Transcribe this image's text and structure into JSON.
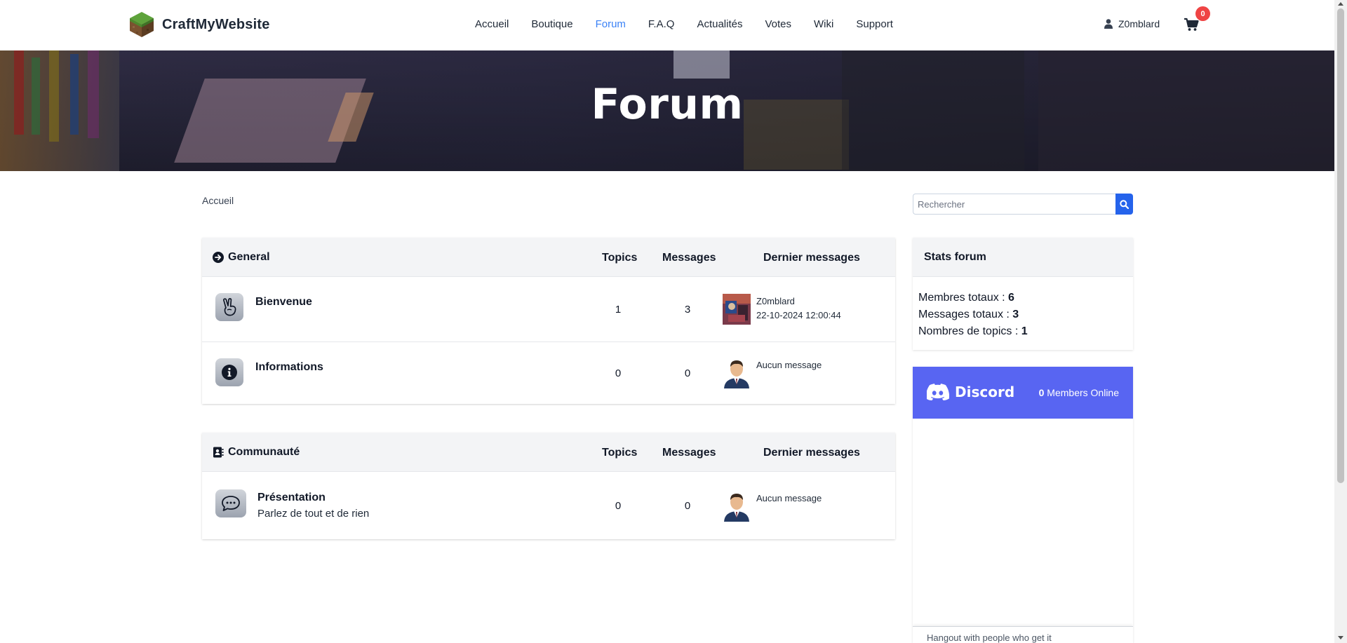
{
  "header": {
    "brand": "CraftMyWebsite",
    "nav": [
      "Accueil",
      "Boutique",
      "Forum",
      "F.A.Q",
      "Actualités",
      "Votes",
      "Wiki",
      "Support"
    ],
    "active_nav": "Forum",
    "username": "Z0mblard",
    "cart_count": "0"
  },
  "hero": {
    "title": "Forum"
  },
  "breadcrumb": "Accueil",
  "search": {
    "placeholder": "Rechercher"
  },
  "columns": {
    "topics": "Topics",
    "messages": "Messages",
    "last": "Dernier messages"
  },
  "categories": [
    {
      "name": "General",
      "icon": "arrow-circle-right-icon",
      "forums": [
        {
          "name": "Bienvenue",
          "description": "",
          "icon": "hand-peace-icon",
          "topics": "1",
          "messages": "3",
          "last_author": "Z0mblard",
          "last_date": "22-10-2024 12:00:44"
        },
        {
          "name": "Informations",
          "description": "",
          "icon": "info-circle-icon",
          "topics": "0",
          "messages": "0",
          "last_author": "Aucun message",
          "last_date": ""
        }
      ]
    },
    {
      "name": "Communauté",
      "icon": "address-book-icon",
      "forums": [
        {
          "name": "Présentation",
          "description": "Parlez de tout et de rien",
          "icon": "comment-dots-icon",
          "topics": "0",
          "messages": "0",
          "last_author": "Aucun message",
          "last_date": ""
        }
      ]
    }
  ],
  "stats": {
    "title": "Stats forum",
    "members_label": "Membres totaux : ",
    "members": "6",
    "messages_label": "Messages totaux : ",
    "messages": "3",
    "topics_label": "Nombres de topics : ",
    "topics": "1"
  },
  "discord": {
    "brand": "Discord",
    "online_count": "0",
    "online_label": " Members Online",
    "footer": "Hangout with people who get it"
  },
  "colors": {
    "accent": "#3b82f6",
    "discord": "#5865f2",
    "badge": "#ef4444",
    "search_button": "#2563eb"
  }
}
